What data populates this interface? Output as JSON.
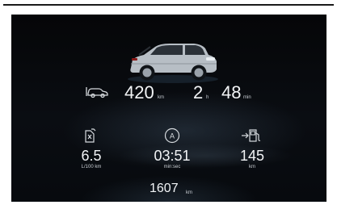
{
  "range": {
    "value": "420",
    "unit": "km"
  },
  "time_left": {
    "hours": "2",
    "hours_unit": "h",
    "minutes": "48",
    "minutes_unit": "min"
  },
  "consumption": {
    "value": "6.5",
    "unit": "L/100 km"
  },
  "trip_time": {
    "value": "03:51",
    "unit": "min:sec"
  },
  "distance": {
    "value": "145",
    "unit": "km"
  },
  "odometer": {
    "value": "1607",
    "unit": "km"
  },
  "icons": {
    "range": "car-range-icon",
    "consumption": "fuel-consumption-icon",
    "trip": "trip-a-icon",
    "distance": "fuel-pump-distance-icon"
  },
  "colors": {
    "background": "#06080b",
    "text": "#f2f4f6",
    "unit": "#c9ced4",
    "icon": "#d6dade"
  }
}
